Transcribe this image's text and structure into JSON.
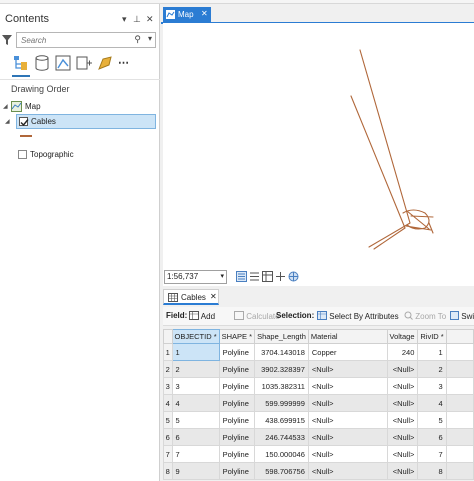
{
  "contents": {
    "title": "Contents",
    "search": {
      "placeholder": "Search"
    },
    "drawing_order_label": "Drawing Order",
    "layers": {
      "map": "Map",
      "cables": "Cables",
      "topographic": "Topographic"
    }
  },
  "map_view": {
    "tab_label": "Map",
    "scale": "1:56,737"
  },
  "table": {
    "tab_label": "Cables",
    "toolbar": {
      "field_label": "Field:",
      "add": "Add",
      "calculate": "Calculate",
      "selection_label": "Selection:",
      "select_by_attributes": "Select By Attributes",
      "zoom_to": "Zoom To",
      "switch": "Swi"
    },
    "columns": [
      "OBJECTID *",
      "SHAPE *",
      "Shape_Length",
      "Material",
      "Voltage",
      "RivID *"
    ],
    "rows": [
      {
        "n": "1",
        "oid": "1",
        "shape": "Polyline",
        "len": "3704.143018",
        "mat": "Copper",
        "volt": "240",
        "riv": "1"
      },
      {
        "n": "2",
        "oid": "2",
        "shape": "Polyline",
        "len": "3902.328397",
        "mat": "<Null>",
        "volt": "<Null>",
        "riv": "2"
      },
      {
        "n": "3",
        "oid": "3",
        "shape": "Polyline",
        "len": "1035.382311",
        "mat": "<Null>",
        "volt": "<Null>",
        "riv": "3"
      },
      {
        "n": "4",
        "oid": "4",
        "shape": "Polyline",
        "len": "599.999999",
        "mat": "<Null>",
        "volt": "<Null>",
        "riv": "4"
      },
      {
        "n": "5",
        "oid": "5",
        "shape": "Polyline",
        "len": "438.699915",
        "mat": "<Null>",
        "volt": "<Null>",
        "riv": "5"
      },
      {
        "n": "6",
        "oid": "6",
        "shape": "Polyline",
        "len": "246.744533",
        "mat": "<Null>",
        "volt": "<Null>",
        "riv": "6"
      },
      {
        "n": "7",
        "oid": "7",
        "shape": "Polyline",
        "len": "150.000046",
        "mat": "<Null>",
        "volt": "<Null>",
        "riv": "7"
      },
      {
        "n": "8",
        "oid": "9",
        "shape": "Polyline",
        "len": "598.706756",
        "mat": "<Null>",
        "volt": "<Null>",
        "riv": "8"
      }
    ]
  },
  "colors": {
    "accent": "#2b7cd3",
    "cable_line": "#b0673a",
    "selection": "#cce4f7"
  },
  "icons": [
    "filter-icon",
    "search-icon",
    "list-by-drawing-order-icon",
    "list-by-source-icon",
    "list-by-selection-icon",
    "list-by-editing-icon",
    "list-by-snapping-icon",
    "more-icon",
    "map-icon",
    "layer-checkbox-icon",
    "table-icon"
  ]
}
